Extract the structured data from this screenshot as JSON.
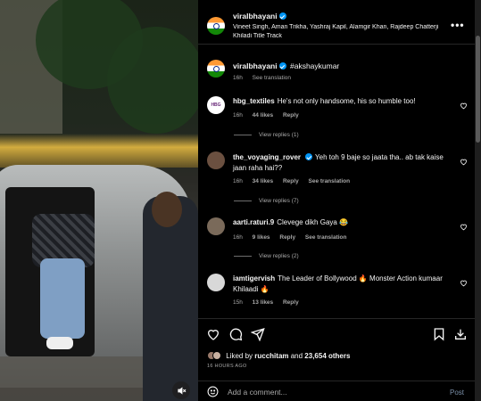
{
  "post": {
    "author": "viralbhayani",
    "collaborators_line": "Vineet Singh, Aman Trikha, Yashraj Kapil, Alamgir Khan, Rajdeep Chatterji",
    "audio_line": "Khiladi Title Track",
    "caption": "#akshaykumar",
    "caption_time": "16h",
    "see_translation": "See translation"
  },
  "comments": [
    {
      "username": "hbg_textiles",
      "avatar_text": "HBG",
      "text": "He's not only handsome, his so humble too!",
      "time": "16h",
      "likes": "44 likes",
      "reply": "Reply",
      "view_replies": "View replies (1)"
    },
    {
      "username": "the_voyaging_rover",
      "text": "Yeh toh 9 baje so jaata tha.. ab tak kaise jaan raha hai??",
      "time": "16h",
      "likes": "34 likes",
      "reply": "Reply",
      "translation": "See translation",
      "view_replies": "View replies (7)"
    },
    {
      "username": "aarti.raturi.9",
      "text": "Clevege dikh Gaya 😂",
      "time": "16h",
      "likes": "9 likes",
      "reply": "Reply",
      "translation": "See translation",
      "view_replies": "View replies (2)"
    },
    {
      "username": "iamtigervish",
      "text": "The Leader of Bollywood 🔥 Monster Action kumaar Khilaadi 🔥",
      "time": "15h",
      "likes": "13 likes",
      "reply": "Reply"
    }
  ],
  "likes_summary": {
    "prefix": "Liked by ",
    "user": "rucchitam",
    "middle": " and ",
    "count": "23,654 others"
  },
  "time_ago": "16 HOURS AGO",
  "add_comment": {
    "placeholder": "Add a comment...",
    "post_label": "Post"
  },
  "colors": {
    "background": "#000000",
    "verified": "#0095f6",
    "secondary_text": "#a8a8a8",
    "post_button_inactive": "#7a8fa8"
  },
  "icons": [
    "verified-badge-icon",
    "more-options-icon",
    "heart-icon",
    "comment-icon",
    "share-icon",
    "bookmark-icon",
    "download-icon",
    "emoji-icon",
    "mute-icon"
  ]
}
